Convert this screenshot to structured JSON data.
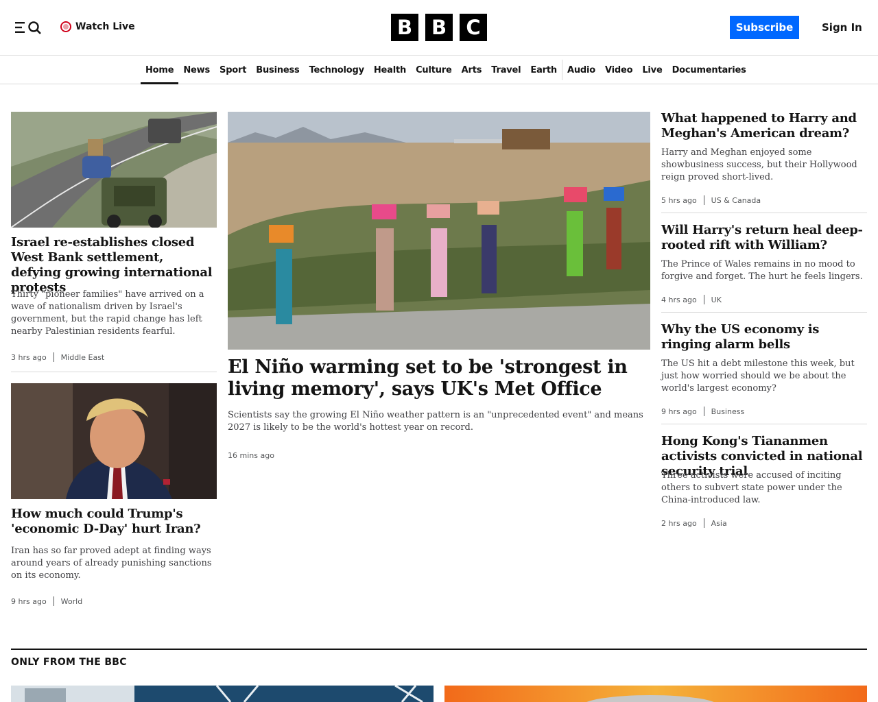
{
  "header": {
    "watch_live": "Watch Live",
    "logo_letters": [
      "B",
      "B",
      "C"
    ],
    "subscribe": "Subscribe",
    "sign_in": "Sign In",
    "brand_color": "#0068ff",
    "live_color": "#d0021b"
  },
  "nav": {
    "items": [
      "Home",
      "News",
      "Sport",
      "Business",
      "Technology",
      "Health",
      "Culture",
      "Arts",
      "Travel",
      "Earth",
      "Audio",
      "Video",
      "Live",
      "Documentaries"
    ],
    "active": "Home"
  },
  "left_stories": [
    {
      "headline": "Israel re-establishes closed West Bank settlement, defying growing international protests",
      "summary": "Thirty \"pioneer families\" have arrived on a wave of nationalism driven by Israel's government, but the rapid change has left nearby Palestinian residents fearful.",
      "time": "3 hrs ago",
      "tag": "Middle East"
    },
    {
      "headline": "How much could Trump's 'economic D-Day' hurt Iran?",
      "summary": "Iran has so far proved adept at finding ways around years of already punishing sanctions on its economy.",
      "time": "9 hrs ago",
      "tag": "World"
    }
  ],
  "main_story": {
    "headline": "El Niño warming set to be 'strongest in living memory', says UK's Met Office",
    "summary": "Scientists say the growing El Niño weather pattern is an \"unprecedented event\" and means 2027 is likely to be the world's hottest year on record.",
    "time": "16 mins ago"
  },
  "right_stories": [
    {
      "headline": "What happened to Harry and Meghan's American dream?",
      "summary": "Harry and Meghan enjoyed some showbusiness success, but their Hollywood reign proved short-lived.",
      "time": "5 hrs ago",
      "tag": "US & Canada"
    },
    {
      "headline": "Will Harry's return heal deep-rooted rift with William?",
      "summary": "The Prince of Wales remains in no mood to forgive and forget. The hurt he feels lingers.",
      "time": "4 hrs ago",
      "tag": "UK"
    },
    {
      "headline": "Why the US economy is ringing alarm bells",
      "summary": "The US hit a debt milestone this week, but just how worried should we be about the world's largest economy?",
      "time": "9 hrs ago",
      "tag": "Business"
    },
    {
      "headline": "Hong Kong's Tiananmen activists convicted in national security trial",
      "summary": "Three activists were accused of inciting others to subvert state power under the China-introduced law.",
      "time": "2 hrs ago",
      "tag": "Asia"
    }
  ],
  "section": {
    "title": "ONLY FROM THE BBC"
  }
}
